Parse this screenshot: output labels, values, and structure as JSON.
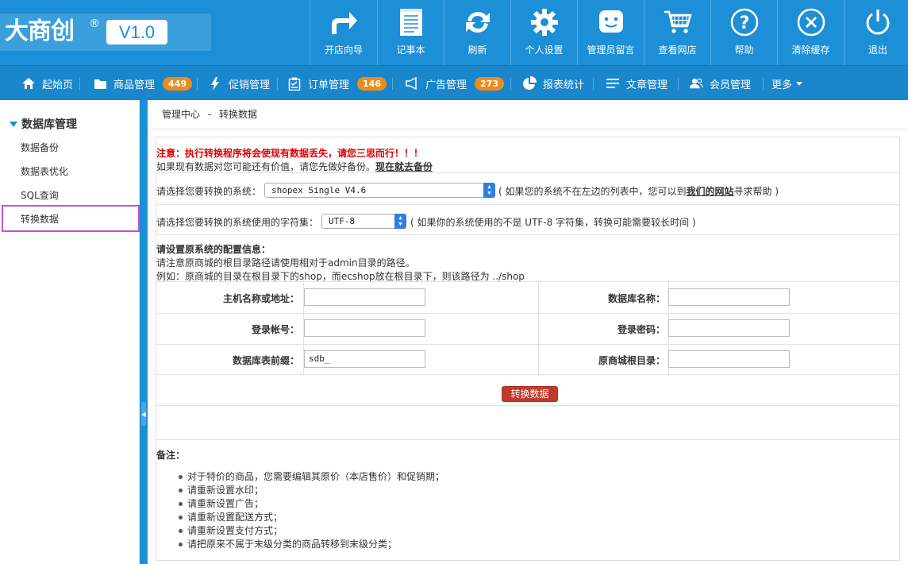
{
  "brand": {
    "name": "大商创",
    "reg": "®",
    "version": "V1.0"
  },
  "top_nav": [
    {
      "label": "开店向导",
      "icon": "share-arrow-icon"
    },
    {
      "label": "记事本",
      "icon": "notepad-icon"
    },
    {
      "label": "刷新",
      "icon": "refresh-icon"
    },
    {
      "label": "个人设置",
      "icon": "gear-icon"
    },
    {
      "label": "管理员留言",
      "icon": "message-icon"
    },
    {
      "label": "查看网店",
      "icon": "cart-icon"
    },
    {
      "label": "帮助",
      "icon": "help-icon"
    },
    {
      "label": "清除缓存",
      "icon": "close-circle-icon"
    },
    {
      "label": "退出",
      "icon": "power-icon"
    }
  ],
  "main_nav": [
    {
      "label": "起始页",
      "icon": "home-icon"
    },
    {
      "label": "商品管理",
      "icon": "folder-icon",
      "badge": "449"
    },
    {
      "label": "促销管理",
      "icon": "lightning-icon"
    },
    {
      "label": "订单管理",
      "icon": "clipboard-icon",
      "badge": "146"
    },
    {
      "label": "广告管理",
      "icon": "megaphone-icon",
      "badge": "273"
    },
    {
      "label": "报表统计",
      "icon": "pie-chart-icon"
    },
    {
      "label": "文章管理",
      "icon": "list-icon"
    },
    {
      "label": "会员管理",
      "icon": "users-icon"
    },
    {
      "label": "更多",
      "icon": "caret-down-icon"
    }
  ],
  "sidebar": {
    "title": "数据库管理",
    "items": [
      "数据备份",
      "数据表优化",
      "SQL查询",
      "转换数据"
    ],
    "active_index": 3
  },
  "breadcrumb": {
    "root": "管理中心",
    "sep": "-",
    "current": "转换数据"
  },
  "warning": {
    "line1": "注意：执行转换程序将会使现有数据丢失，请您三思而行！！！",
    "line2": "如果现有数据对您可能还有价值，请您先做好备份。",
    "backup_link": "现在就去备份"
  },
  "system_select": {
    "label": "请选择您要转换的系统：",
    "value": "shopex Single V4.6",
    "help_prefix": "( 如果您的系统不在左边的列表中，您可以到",
    "help_link": "我们的网站",
    "help_suffix": "寻求帮助 )"
  },
  "charset_select": {
    "label": "请选择您要转换的系统使用的字符集：",
    "value": "UTF-8",
    "help": "( 如果你的系统使用的不是 UTF-8 字符集，转换可能需要较长时间 )"
  },
  "config": {
    "title": "请设置原系统的配置信息：",
    "line1": "请注意原商城的根目录路径请使用相对于admin目录的路径。",
    "line2": "例如：原商城的目录在根目录下的shop，而ecshop放在根目录下，则该路径为 ../shop"
  },
  "fields": {
    "host": {
      "label": "主机名称或地址：",
      "value": ""
    },
    "dbname": {
      "label": "数据库名称：",
      "value": ""
    },
    "user": {
      "label": "登录帐号：",
      "value": ""
    },
    "password": {
      "label": "登录密码：",
      "value": ""
    },
    "prefix": {
      "label": "数据库表前缀：",
      "value": "sdb_"
    },
    "rootdir": {
      "label": "原商城根目录：",
      "value": ""
    }
  },
  "submit_label": "转换数据",
  "notes": {
    "title": "备注：",
    "items": [
      "对于特价的商品，您需要编辑其原价（本店售价）和促销期；",
      "请重新设置水印；",
      "请重新设置广告；",
      "请重新设置配送方式；",
      "请重新设置支付方式；",
      "请把原来不属于末级分类的商品转移到末级分类；"
    ]
  },
  "colors": {
    "primary": "#1c8fd6",
    "badge": "#f08c1a",
    "warning": "#e00000",
    "button": "#c0392b",
    "active_outline": "#c74fd1"
  }
}
